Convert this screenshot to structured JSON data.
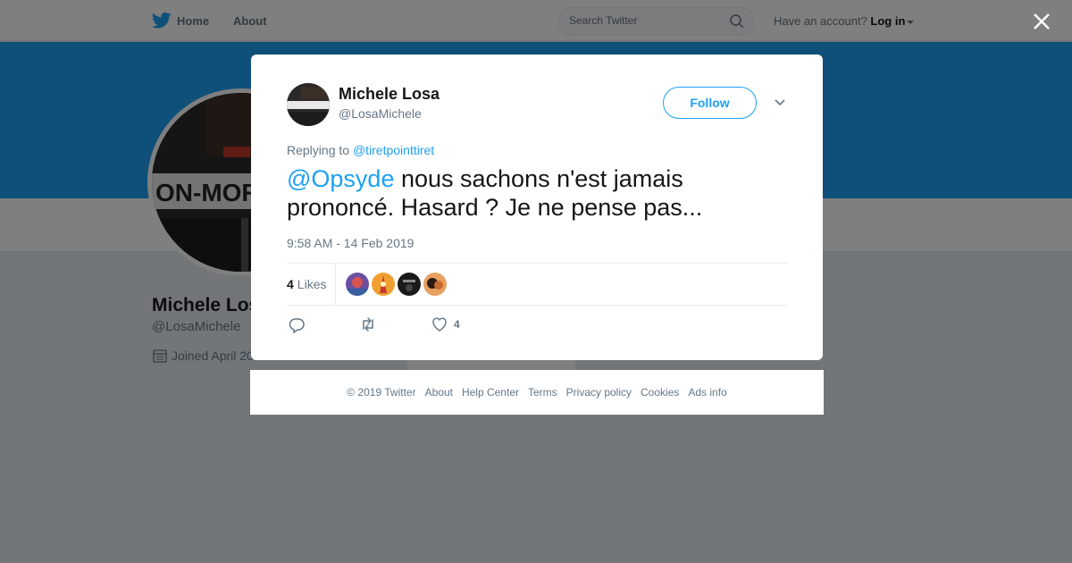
{
  "topbar": {
    "home_label": "Home",
    "about_label": "About",
    "search_placeholder": "Search Twitter",
    "account_prompt": "Have an account?",
    "login_label": "Log in"
  },
  "profile": {
    "name": "Michele Los",
    "handle": "@LosaMichele",
    "joined": "Joined April 20",
    "avatar_text": "ON-MOR"
  },
  "tweet": {
    "fullname": "Michele Losa",
    "username": "@LosaMichele",
    "follow_label": "Follow",
    "replying_prefix": "Replying to",
    "replying_to": "@tiretpointtiret",
    "mention": "@Opsyde",
    "text": " nous sachons n'est jamais prononcé. Hasard ? Je ne pense pas...",
    "timestamp": "9:58 AM - 14 Feb 2019",
    "likes_count": "4",
    "likes_label": "Likes",
    "like_action_count": "4"
  },
  "footer": {
    "copyright": "© 2019 Twitter",
    "links": [
      "About",
      "Help Center",
      "Terms",
      "Privacy policy",
      "Cookies",
      "Ads info"
    ]
  },
  "colors": {
    "accent": "#1da1f2",
    "banner": "#1da1f2",
    "secondary_text": "#657786"
  },
  "icons": {
    "brand": "twitter-bird-icon",
    "search": "search-icon",
    "close": "close-icon",
    "reply": "reply-icon",
    "retweet": "retweet-icon",
    "like": "heart-icon",
    "calendar": "calendar-icon",
    "more": "chevron-down-icon"
  }
}
